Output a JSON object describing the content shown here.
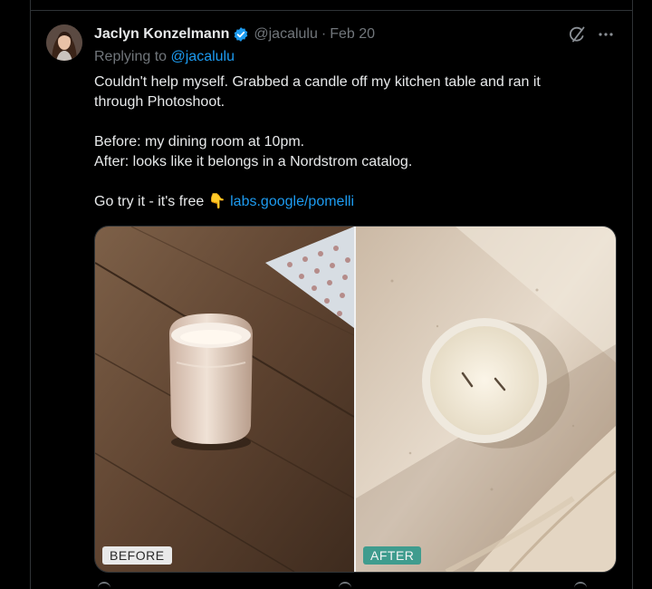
{
  "tweet": {
    "author_name": "Jaclyn Konzelmann",
    "handle": "@jacalulu",
    "separator": "·",
    "date": "Feb 20",
    "replying_prefix": "Replying to",
    "replying_handle": "@jacalulu",
    "lines": [
      "Couldn't help myself. Grabbed a candle off my kitchen table and ran it",
      "through Photoshoot.",
      "Before: my dining room at 10pm.",
      "After: looks like it belongs in a Nordstrom catalog.",
      "Go try it - it's free"
    ],
    "emoji": "👇",
    "link_text": "labs.google/pomelli"
  },
  "media": {
    "before_label": "BEFORE",
    "after_label": "AFTER"
  },
  "icons": {
    "grok": "grok-icon",
    "more": "more-icon",
    "verified": "verified-badge-icon"
  },
  "colors": {
    "background": "#000000",
    "text": "#e7e9ea",
    "muted": "#71767b",
    "link": "#1d9bf0",
    "after_tag": "#3f9c8e"
  }
}
